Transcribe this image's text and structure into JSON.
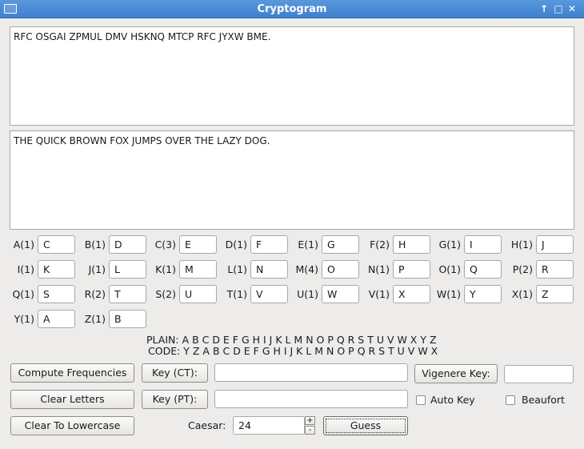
{
  "window": {
    "title": "Cryptogram"
  },
  "ciphertext": "RFC OSGAI ZPMUL DMV HSKNQ MTCP RFC JYXW BME.",
  "plaintext": "THE QUICK BROWN FOX JUMPS OVER THE LAZY DOG.",
  "letters": [
    {
      "label": "A(1)",
      "value": "C"
    },
    {
      "label": "B(1)",
      "value": "D"
    },
    {
      "label": "C(3)",
      "value": "E"
    },
    {
      "label": "D(1)",
      "value": "F"
    },
    {
      "label": "E(1)",
      "value": "G"
    },
    {
      "label": "F(2)",
      "value": "H"
    },
    {
      "label": "G(1)",
      "value": "I"
    },
    {
      "label": "H(1)",
      "value": "J"
    },
    {
      "label": "I(1)",
      "value": "K"
    },
    {
      "label": "J(1)",
      "value": "L"
    },
    {
      "label": "K(1)",
      "value": "M"
    },
    {
      "label": "L(1)",
      "value": "N"
    },
    {
      "label": "M(4)",
      "value": "O"
    },
    {
      "label": "N(1)",
      "value": "P"
    },
    {
      "label": "O(1)",
      "value": "Q"
    },
    {
      "label": "P(2)",
      "value": "R"
    },
    {
      "label": "Q(1)",
      "value": "S"
    },
    {
      "label": "R(2)",
      "value": "T"
    },
    {
      "label": "S(2)",
      "value": "U"
    },
    {
      "label": "T(1)",
      "value": "V"
    },
    {
      "label": "U(1)",
      "value": "W"
    },
    {
      "label": "V(1)",
      "value": "X"
    },
    {
      "label": "W(1)",
      "value": "Y"
    },
    {
      "label": "X(1)",
      "value": "Z"
    },
    {
      "label": "Y(1)",
      "value": "A"
    },
    {
      "label": "Z(1)",
      "value": "B"
    }
  ],
  "alphabet": {
    "plain": "PLAIN: A B C D E F G H I J K L M N O P Q R S T U V W X Y Z",
    "code": "CODE: Y Z A B C D E F G H I J K L M N O P Q R S T U V W X"
  },
  "controls": {
    "compute_frequencies": "Compute Frequencies",
    "clear_letters": "Clear Letters",
    "clear_to_lowercase": "Clear To Lowercase",
    "key_ct": "Key (CT):",
    "key_pt": "Key (PT):",
    "key_ct_value": "",
    "key_pt_value": "",
    "vigenere_key": "Vigenere Key:",
    "vigenere_value": "",
    "auto_key": "Auto Key",
    "beaufort": "Beaufort",
    "caesar_label": "Caesar:",
    "caesar_value": "24",
    "guess": "Guess"
  }
}
